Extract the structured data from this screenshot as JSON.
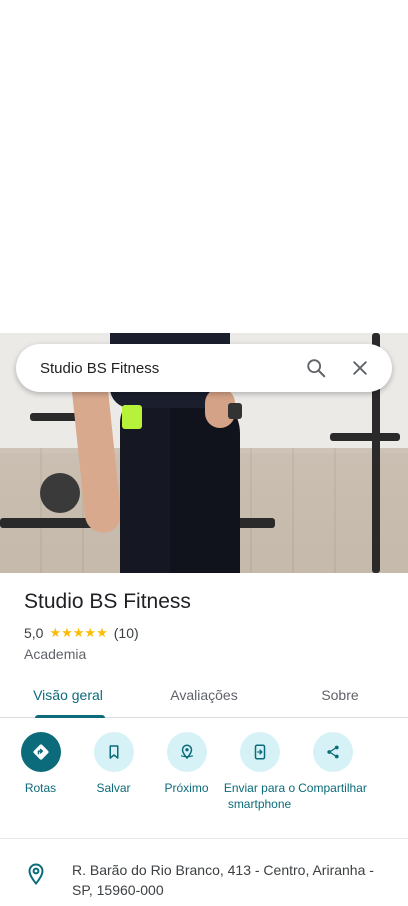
{
  "search": {
    "query": "Studio BS Fitness"
  },
  "place": {
    "name": "Studio BS Fitness",
    "rating": "5,0",
    "stars": "★★★★★",
    "review_count": "(10)",
    "category": "Academia"
  },
  "tabs": [
    {
      "label": "Visão geral",
      "active": true
    },
    {
      "label": "Avaliações",
      "active": false
    },
    {
      "label": "Sobre",
      "active": false
    }
  ],
  "actions": [
    {
      "label": "Rotas",
      "icon": "directions-icon"
    },
    {
      "label": "Salvar",
      "icon": "bookmark-icon"
    },
    {
      "label": "Próximo",
      "icon": "nearby-icon"
    },
    {
      "label": "Enviar para o smartphone",
      "icon": "send-to-phone-icon"
    },
    {
      "label": "Compartilhar",
      "icon": "share-icon"
    }
  ],
  "address": "R. Barão do Rio Branco, 413 - Centro, Ariranha - SP, 15960-000",
  "colors": {
    "accent": "#0b6b7a",
    "accent_light": "#d6f2f6",
    "star": "#fbbc04"
  }
}
